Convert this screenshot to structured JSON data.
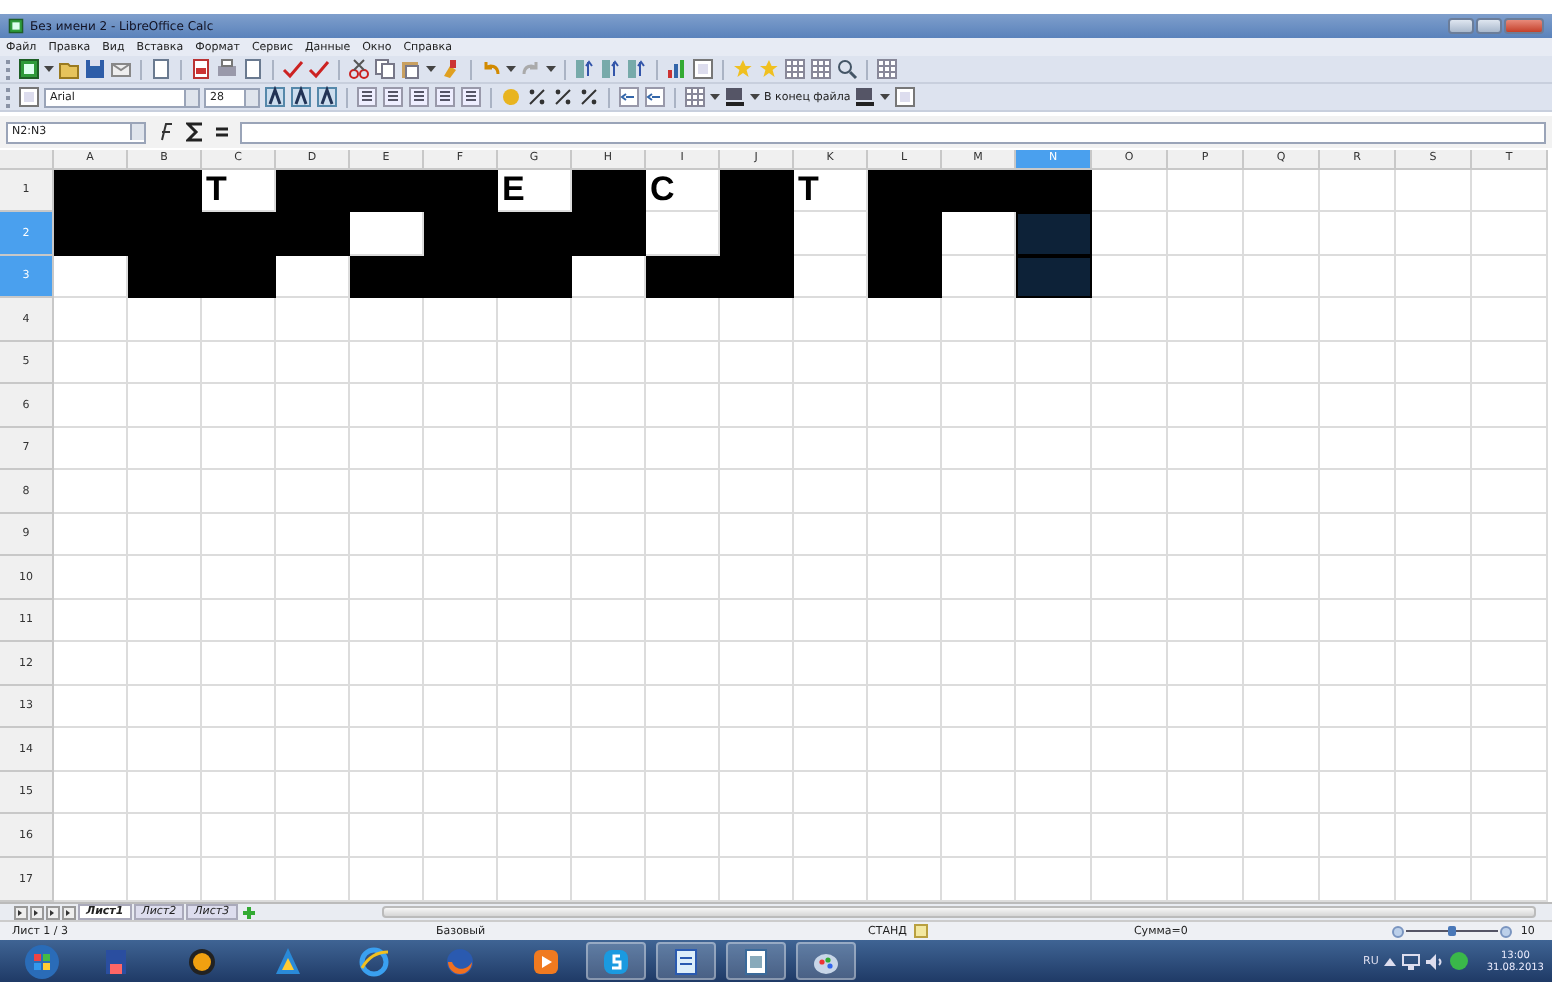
{
  "window": {
    "title": "Без имени 2 - LibreOffice Calc"
  },
  "menu": [
    "Файл",
    "Правка",
    "Вид",
    "Вставка",
    "Формат",
    "Сервис",
    "Данные",
    "Окно",
    "Справка"
  ],
  "format_toolbar": {
    "font": "Arial",
    "size": "28",
    "end_label": "В конец файла"
  },
  "formula_bar": {
    "name_box": "N2:N3"
  },
  "sheet": {
    "columns": [
      {
        "label": "A",
        "selected": false
      },
      {
        "label": "B",
        "selected": false
      },
      {
        "label": "C",
        "selected": false
      },
      {
        "label": "D",
        "selected": false
      },
      {
        "label": "E",
        "selected": false
      },
      {
        "label": "F",
        "selected": false
      },
      {
        "label": "G",
        "selected": false
      },
      {
        "label": "H",
        "selected": false
      },
      {
        "label": "I",
        "selected": false
      },
      {
        "label": "J",
        "selected": false
      },
      {
        "label": "K",
        "selected": false
      },
      {
        "label": "L",
        "selected": false
      },
      {
        "label": "M",
        "selected": false
      },
      {
        "label": "N",
        "selected": true
      },
      {
        "label": "O",
        "selected": false
      },
      {
        "label": "P",
        "selected": false
      },
      {
        "label": "Q",
        "selected": false
      },
      {
        "label": "R",
        "selected": false
      },
      {
        "label": "S",
        "selected": false
      },
      {
        "label": "T",
        "selected": false
      }
    ],
    "rows": [
      {
        "label": "1",
        "selected": false,
        "cells": [
          {
            "filled": true,
            "selected": false
          },
          {
            "filled": true,
            "selected": false
          },
          {
            "filled": false,
            "selected": false,
            "text": "T"
          },
          {
            "filled": true,
            "selected": false
          },
          {
            "filled": true,
            "selected": false
          },
          {
            "filled": true,
            "selected": false
          },
          {
            "filled": false,
            "selected": false,
            "text": "E"
          },
          {
            "filled": true,
            "selected": false
          },
          {
            "filled": false,
            "selected": false,
            "text": "C"
          },
          {
            "filled": true,
            "selected": false
          },
          {
            "filled": false,
            "selected": false,
            "text": "T"
          },
          {
            "filled": true,
            "selected": false
          },
          {
            "filled": true,
            "selected": false
          },
          {
            "filled": true,
            "selected": false
          }
        ]
      },
      {
        "label": "2",
        "selected": true,
        "cells": [
          {
            "filled": true,
            "selected": false
          },
          {
            "filled": true,
            "selected": false
          },
          {
            "filled": true,
            "selected": false
          },
          {
            "filled": true,
            "selected": false
          },
          {
            "filled": false,
            "selected": false
          },
          {
            "filled": true,
            "selected": false
          },
          {
            "filled": true,
            "selected": false
          },
          {
            "filled": true,
            "selected": false
          },
          {
            "filled": false,
            "selected": false
          },
          {
            "filled": true,
            "selected": false
          },
          {
            "filled": false,
            "selected": false
          },
          {
            "filled": true,
            "selected": false
          },
          {
            "filled": false,
            "selected": false
          },
          {
            "filled": true,
            "selected": true
          }
        ]
      },
      {
        "label": "3",
        "selected": true,
        "cells": [
          {
            "filled": false,
            "selected": false
          },
          {
            "filled": true,
            "selected": false
          },
          {
            "filled": true,
            "selected": false
          },
          {
            "filled": false,
            "selected": false
          },
          {
            "filled": true,
            "selected": false
          },
          {
            "filled": true,
            "selected": false
          },
          {
            "filled": true,
            "selected": false
          },
          {
            "filled": false,
            "selected": false
          },
          {
            "filled": true,
            "selected": false
          },
          {
            "filled": true,
            "selected": false
          },
          {
            "filled": false,
            "selected": false
          },
          {
            "filled": true,
            "selected": false
          },
          {
            "filled": false,
            "selected": false
          },
          {
            "filled": true,
            "selected": true
          }
        ]
      },
      {
        "label": "4",
        "selected": false
      },
      {
        "label": "5",
        "selected": false
      },
      {
        "label": "6",
        "selected": false
      },
      {
        "label": "7",
        "selected": false
      },
      {
        "label": "8",
        "selected": false
      },
      {
        "label": "9",
        "selected": false
      },
      {
        "label": "10",
        "selected": false
      },
      {
        "label": "11",
        "selected": false
      },
      {
        "label": "12",
        "selected": false
      },
      {
        "label": "13",
        "selected": false
      },
      {
        "label": "14",
        "selected": false
      },
      {
        "label": "15",
        "selected": false
      },
      {
        "label": "16",
        "selected": false
      },
      {
        "label": "17",
        "selected": false
      }
    ]
  },
  "sheet_tabs": [
    {
      "label": "Лист1",
      "selected": true
    },
    {
      "label": "Лист2",
      "selected": false
    },
    {
      "label": "Лист3",
      "selected": false
    }
  ],
  "status_bar": {
    "sheet": "Лист 1 / 3",
    "style": "Базовый",
    "mode": "СТАНД",
    "sum": "Сумма=0",
    "zoom": {
      "level": 0.5,
      "reading": "10"
    }
  },
  "taskbar": {
    "language": "RU",
    "time": "13:00",
    "date": "31.08.2013"
  }
}
